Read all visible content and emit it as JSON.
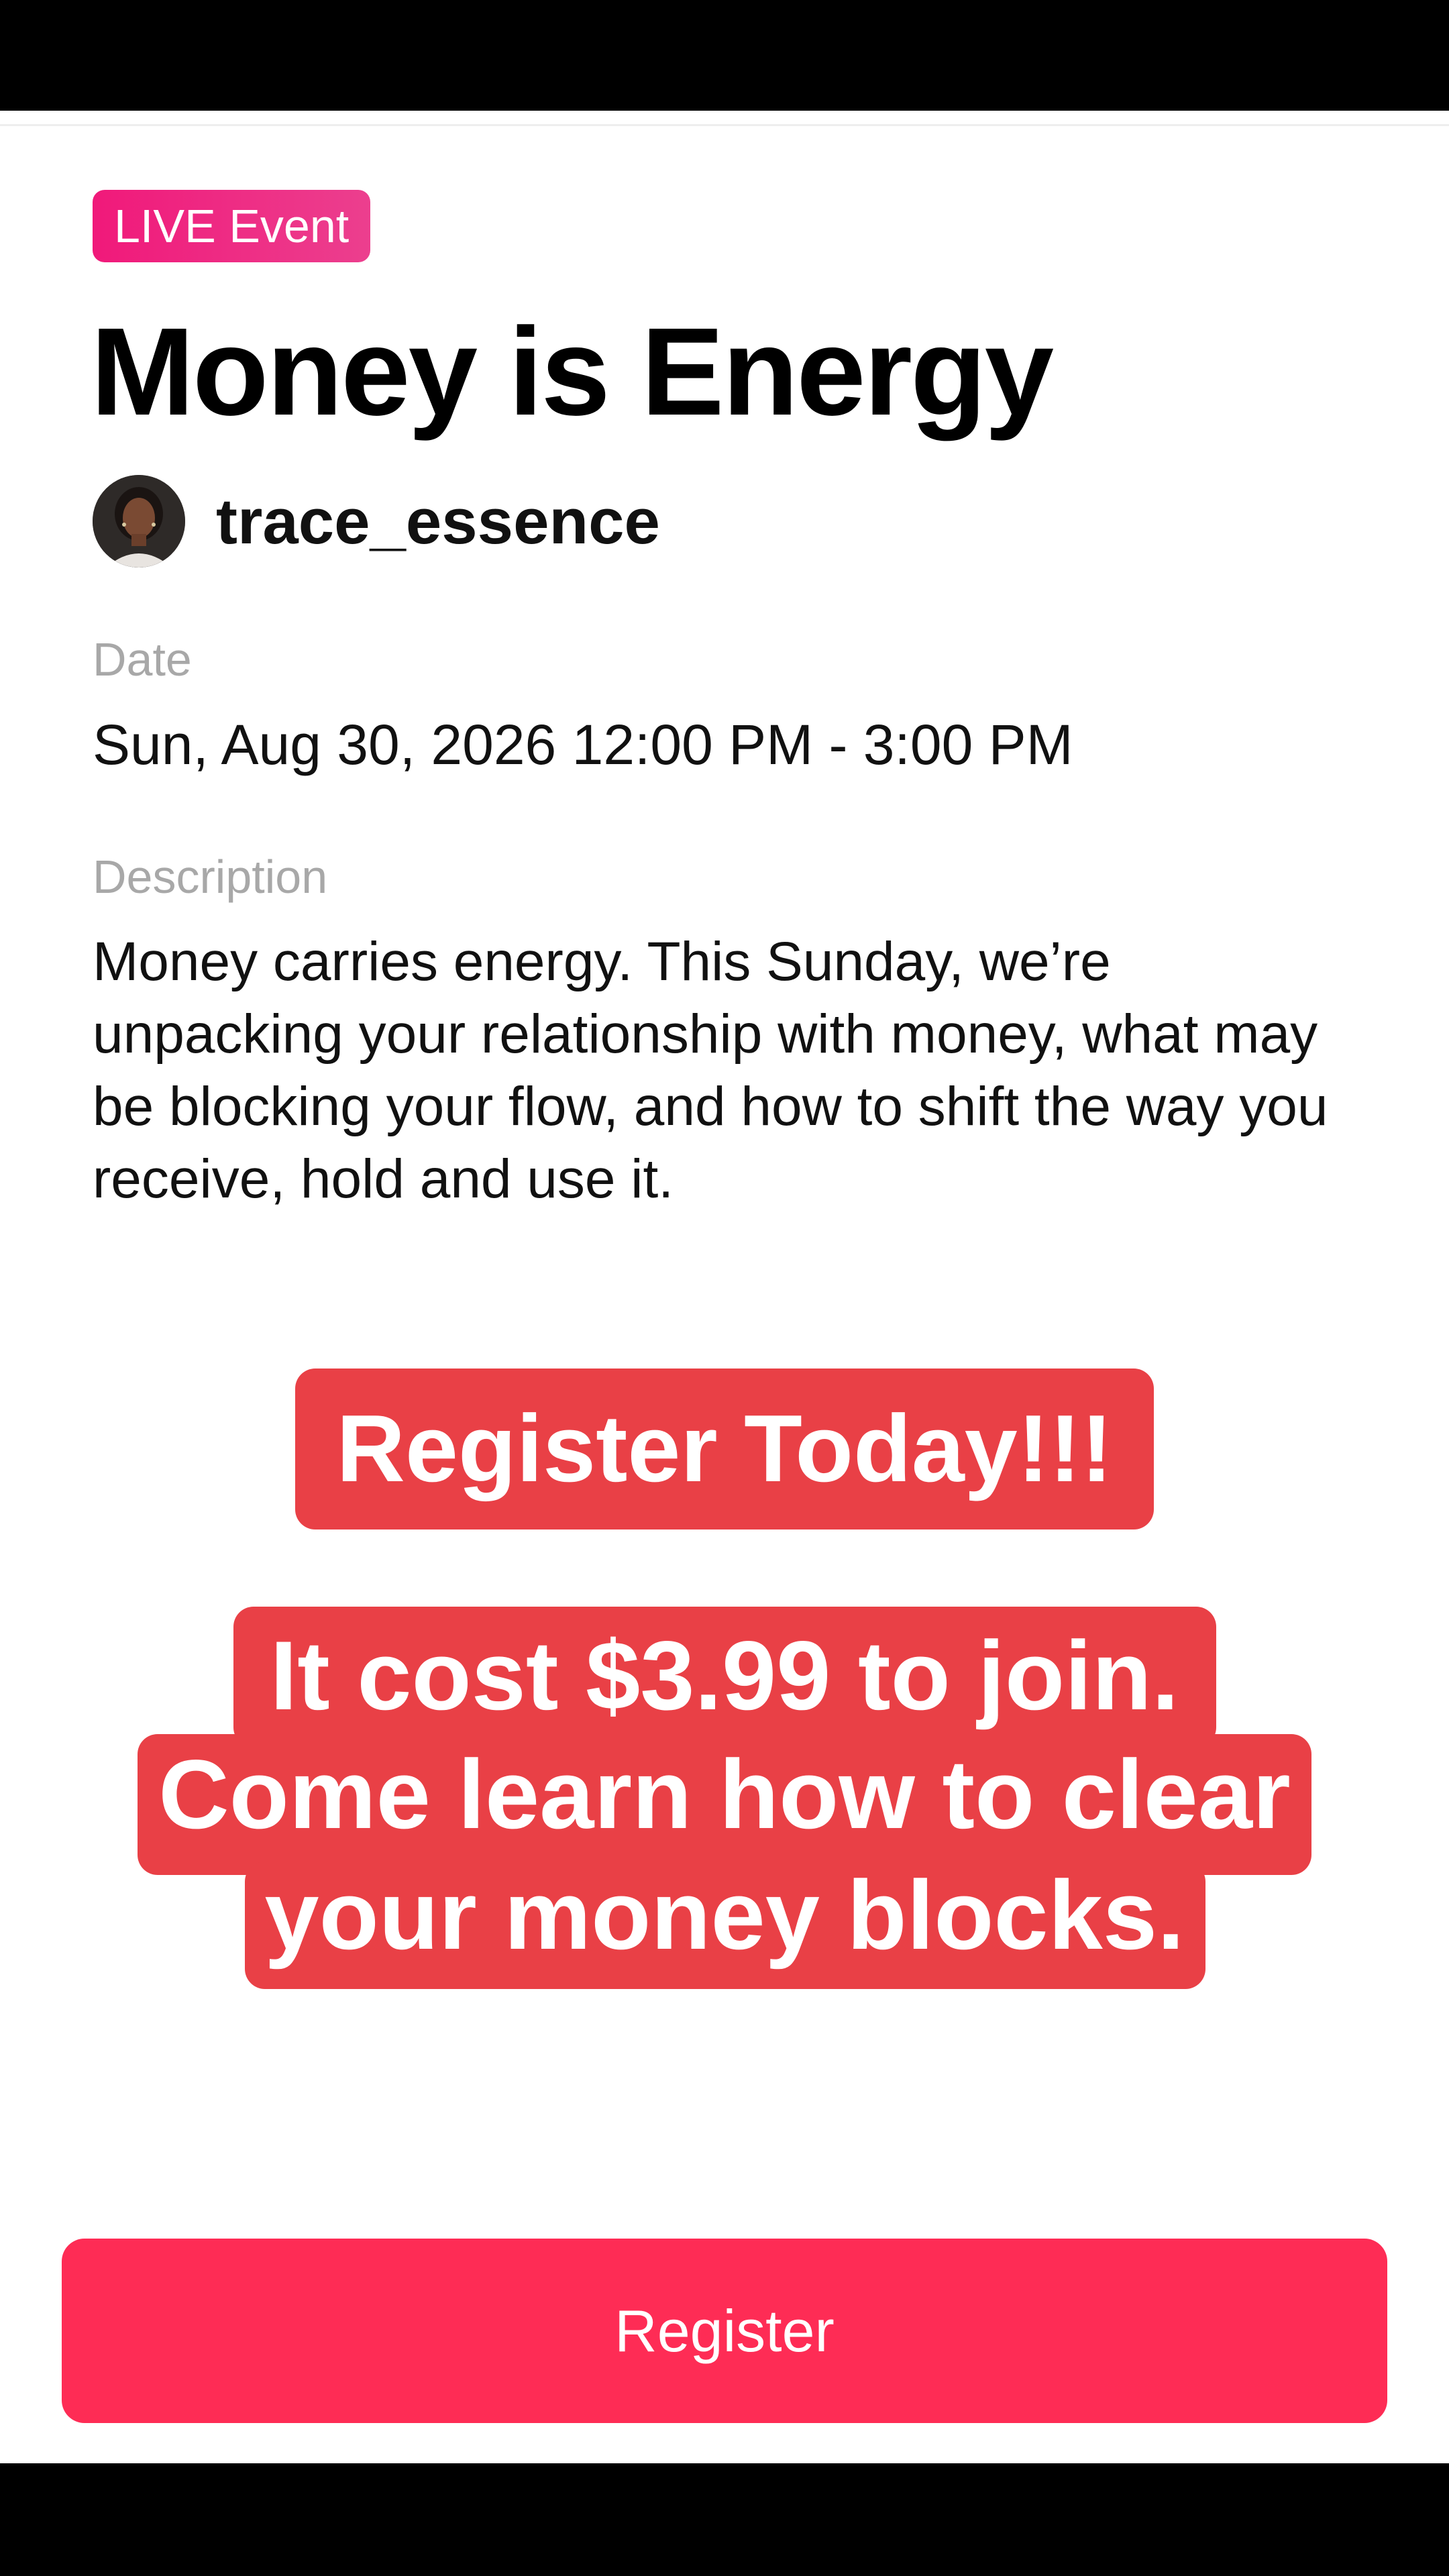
{
  "event": {
    "badge": "LIVE Event",
    "title": "Money is Energy",
    "host_username": "trace_essence",
    "date_label": "Date",
    "date_value": "Sun, Aug 30, 2026 12:00 PM - 3:00 PM",
    "description_label": "Description",
    "description_value": "Money carries energy. This Sunday, we’re unpacking your relationship with money, what may be blocking your flow, and how to shift the way you receive, hold and use it."
  },
  "overlay": {
    "headline": "Register Today!!!",
    "lines": [
      "It cost $3.99 to join.",
      "Come learn how to clear",
      "your money blocks."
    ]
  },
  "actions": {
    "register_label": "Register"
  },
  "colors": {
    "accent": "#fe2c55",
    "badge": "#f0197a",
    "overlay": "#e94046",
    "muted_label": "#a8a8a8"
  },
  "icons": {
    "avatar": "profile-photo"
  }
}
